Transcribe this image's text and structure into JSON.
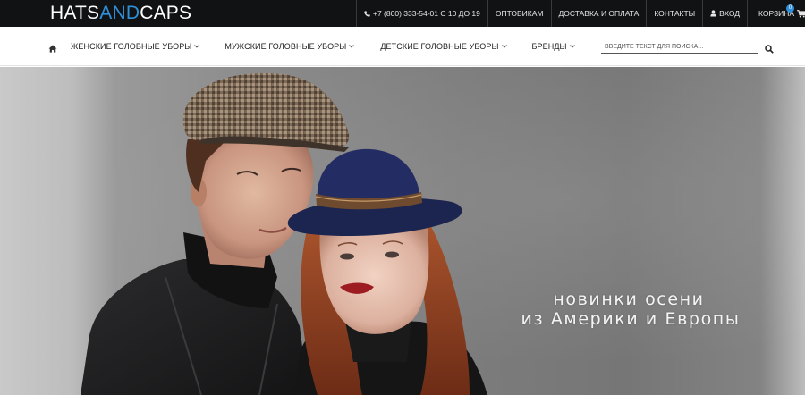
{
  "logo": {
    "part1": "HATS",
    "part2": "AND",
    "part3": "CAPS"
  },
  "topbar": {
    "phone": "+7 (800) 333-54-01 С 10 ДО 19",
    "wholesale": "ОПТОВИКАМ",
    "delivery": "ДОСТАВКА И ОПЛАТА",
    "contacts": "КОНТАКТЫ",
    "login": "ВХОД",
    "cart": "КОРЗИНА",
    "cart_count": "0"
  },
  "nav": {
    "items": [
      {
        "label": "ЖЕНСКИЕ ГОЛОВНЫЕ УБОРЫ"
      },
      {
        "label": "МУЖСКИЕ ГОЛОВНЫЕ УБОРЫ"
      },
      {
        "label": "ДЕТСКИЕ ГОЛОВНЫЕ УБОРЫ"
      },
      {
        "label": "БРЕНДЫ"
      }
    ],
    "search_placeholder": "ВВЕДИТЕ ТЕКСТ ДЛЯ ПОИСКА..."
  },
  "hero": {
    "line1": "новинки осени",
    "line2": "из Америки и Европы"
  },
  "colors": {
    "topbar_bg": "#111214",
    "brand_blue": "#2f8fd8"
  },
  "icons": [
    "phone-icon",
    "user-icon",
    "cart-icon",
    "home-icon",
    "chevron-down-icon",
    "search-icon"
  ]
}
